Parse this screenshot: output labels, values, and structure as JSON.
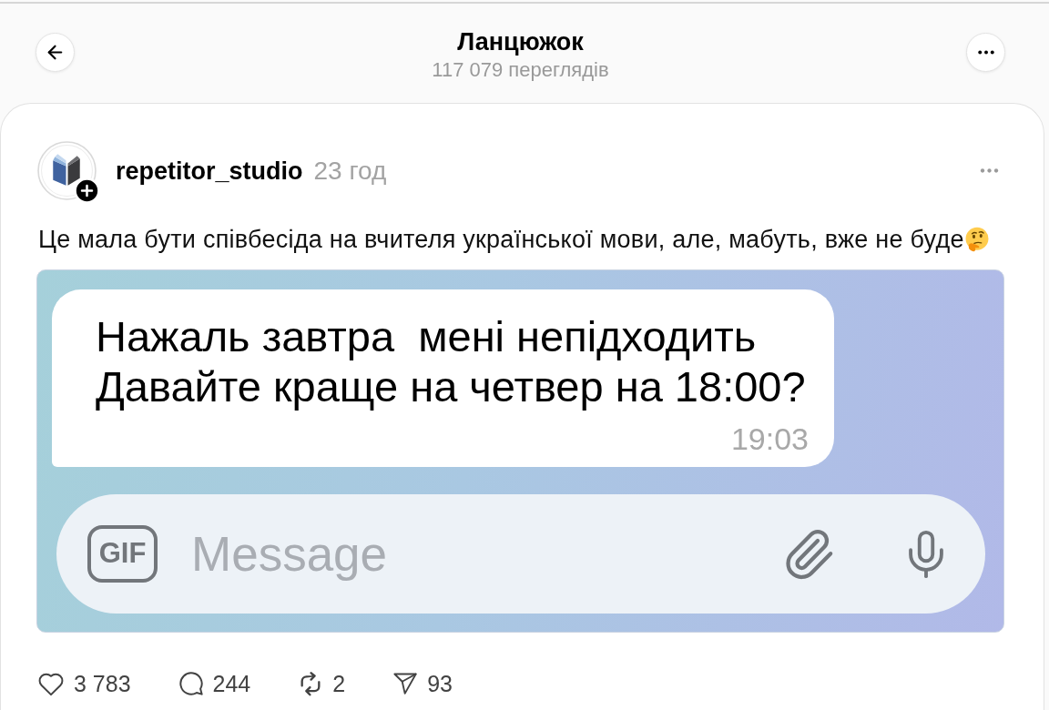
{
  "header": {
    "title": "Ланцюжок",
    "subtitle": "117 079 переглядів"
  },
  "post": {
    "author": "repetitor_studio",
    "time": "23 год",
    "following": false,
    "text": "Це мала бути співбесіда на вчителя української мови, але, мабуть, вже не буде",
    "attachment": {
      "kind": "chat_screenshot",
      "message": {
        "text": "Нажаль завтра  мені непідходить\nДавайте краще на четвер на 18:00?",
        "time": "19:03"
      },
      "composer": {
        "gif_label": "GIF",
        "placeholder": "Message"
      }
    },
    "actions": [
      {
        "kind": "like",
        "count": "3 783"
      },
      {
        "kind": "comment",
        "count": "244"
      },
      {
        "kind": "repost",
        "count": "2"
      },
      {
        "kind": "share",
        "count": "93"
      }
    ]
  }
}
